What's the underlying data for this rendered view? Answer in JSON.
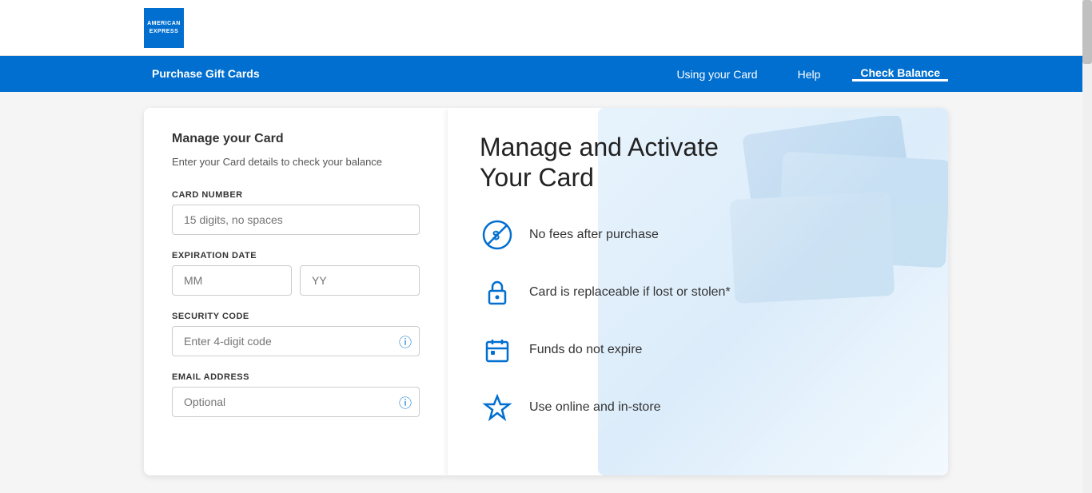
{
  "header": {
    "logo_line1": "AMERICAN",
    "logo_line2": "EXPRESS"
  },
  "nav": {
    "left_item": "Purchase Gift Cards",
    "right_items": [
      {
        "label": "Using your Card",
        "active": false
      },
      {
        "label": "Help",
        "active": false
      },
      {
        "label": "Check Balance",
        "active": true
      }
    ]
  },
  "form": {
    "title": "Manage your Card",
    "subtitle": "Enter your Card details to check your balance",
    "card_number_label": "CARD NUMBER",
    "card_number_placeholder": "15 digits, no spaces",
    "expiration_label": "EXPIRATION DATE",
    "month_placeholder": "MM",
    "year_placeholder": "YY",
    "security_label": "SECURITY CODE",
    "security_placeholder": "Enter 4-digit code",
    "email_label": "EMAIL ADDRESS",
    "email_placeholder": "Optional"
  },
  "info": {
    "title_line1": "Manage and Activate",
    "title_line2": "Your Card",
    "features": [
      {
        "icon": "no-fee-icon",
        "text": "No fees after purchase"
      },
      {
        "icon": "lock-icon",
        "text": "Card is replaceable if lost or stolen*"
      },
      {
        "icon": "calendar-icon",
        "text": "Funds do not expire"
      },
      {
        "icon": "star-icon",
        "text": "Use online and in-store"
      }
    ]
  }
}
